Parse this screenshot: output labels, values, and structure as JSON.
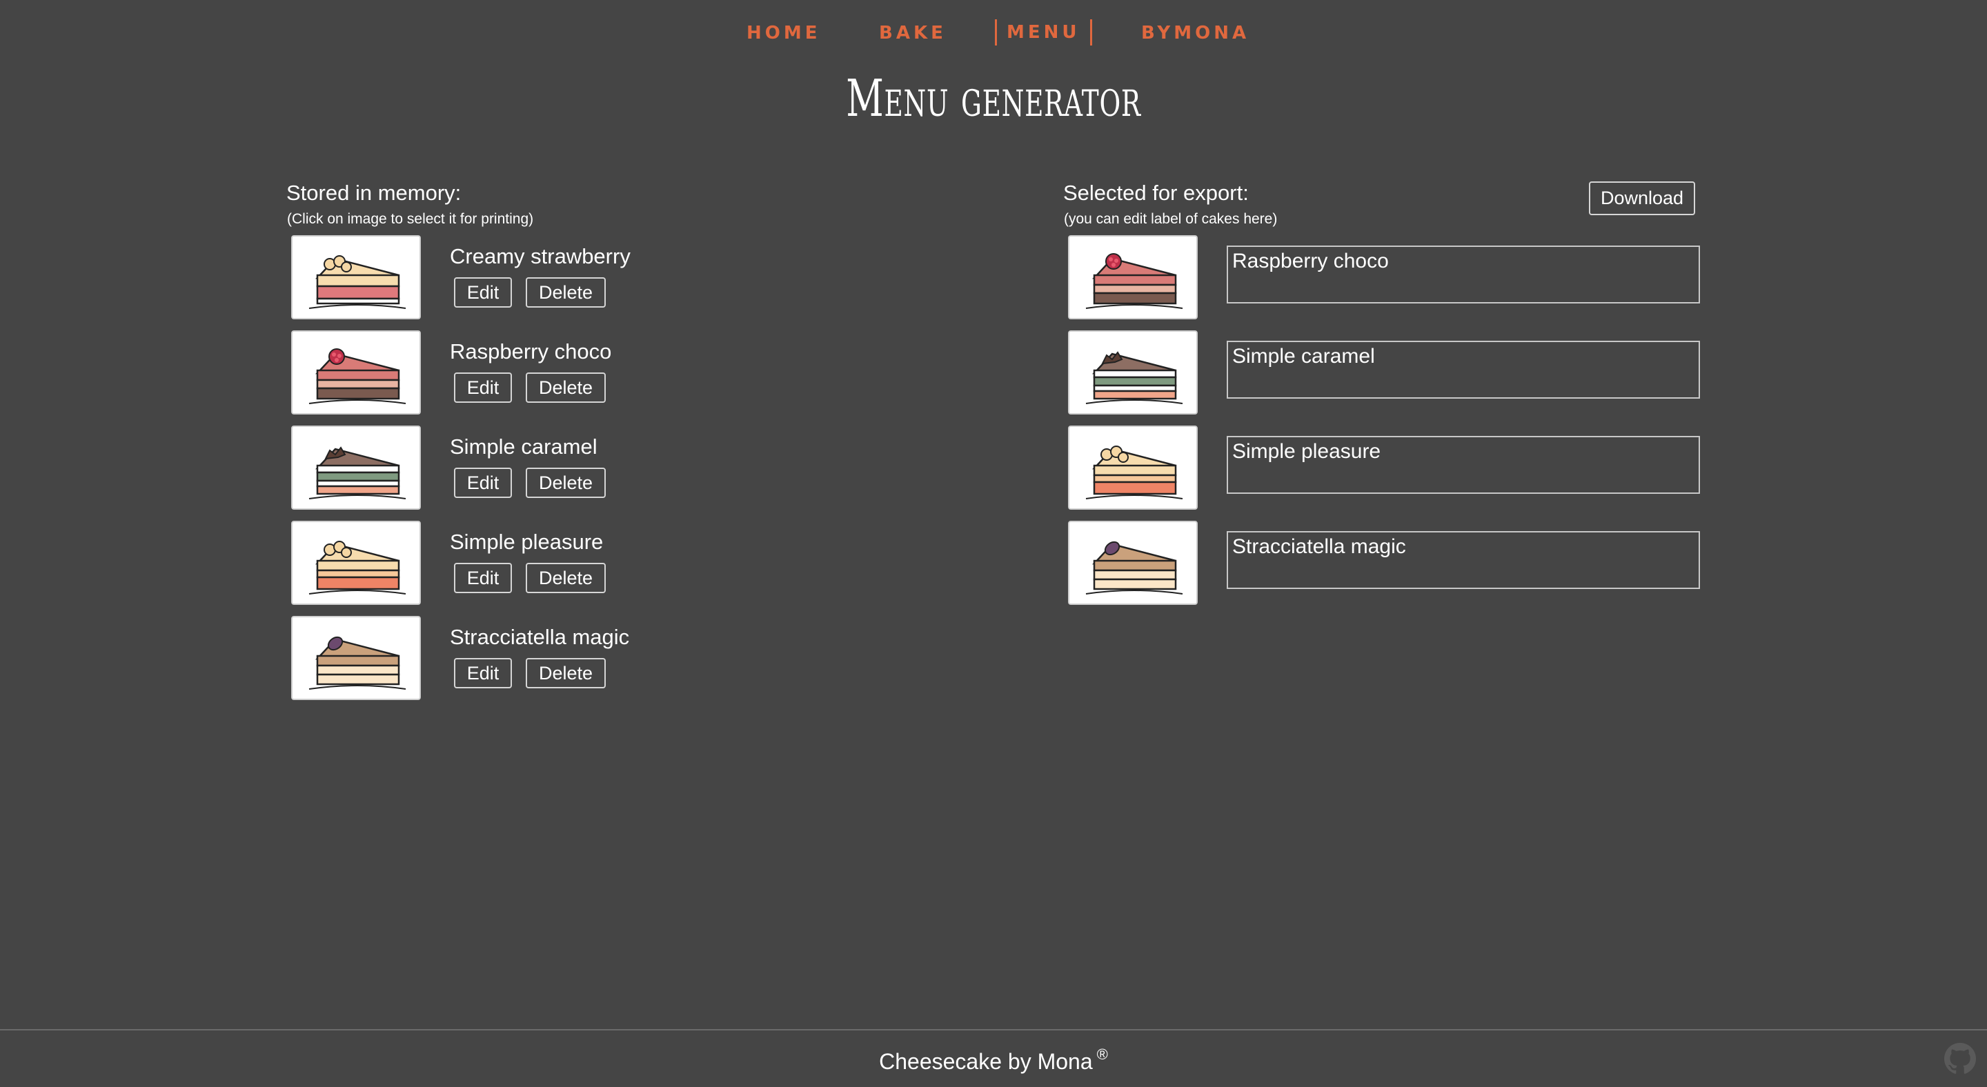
{
  "nav": {
    "home": "HOME",
    "bake": "BAKE",
    "menu": "MENU",
    "bymona": "BYMONA",
    "active_color": "#e0683e"
  },
  "page_title": "Menu generator",
  "stored": {
    "heading": "Stored in memory:",
    "subheading": "(Click on image to select it for printing)",
    "edit_label": "Edit",
    "delete_label": "Delete",
    "cakes": [
      {
        "name": "Creamy strawberry",
        "icon": "cake-creamy-strawberry-icon"
      },
      {
        "name": "Raspberry choco",
        "icon": "cake-raspberry-choco-icon"
      },
      {
        "name": "Simple caramel",
        "icon": "cake-simple-caramel-icon"
      },
      {
        "name": "Simple pleasure",
        "icon": "cake-simple-pleasure-icon"
      },
      {
        "name": "Stracciatella magic",
        "icon": "cake-stracciatella-magic-icon"
      }
    ]
  },
  "export": {
    "heading": "Selected for export:",
    "subheading": "(you can edit label of cakes here)",
    "download_label": "Download",
    "cakes": [
      {
        "label": "Raspberry choco",
        "icon": "cake-raspberry-choco-icon"
      },
      {
        "label": "Simple caramel",
        "icon": "cake-simple-caramel-icon"
      },
      {
        "label": "Simple pleasure",
        "icon": "cake-simple-pleasure-icon"
      },
      {
        "label": "Stracciatella magic",
        "icon": "cake-stracciatella-magic-icon"
      }
    ]
  },
  "footer": {
    "text": "Cheesecake by Mona",
    "mark": "®",
    "github_icon": "github-icon"
  },
  "colors": {
    "background": "#454545",
    "accent": "#e0683e"
  }
}
